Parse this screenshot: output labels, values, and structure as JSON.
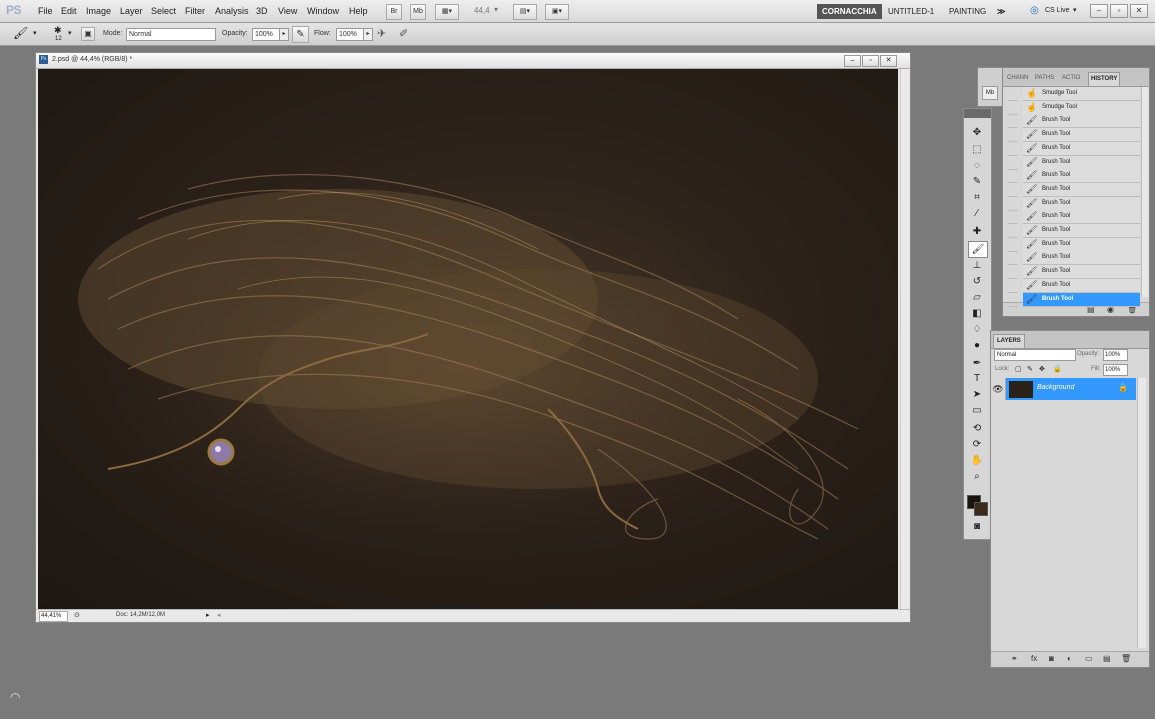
{
  "menubar": {
    "logo": "PS",
    "items": [
      "File",
      "Edit",
      "Image",
      "Layer",
      "Select",
      "Filter",
      "Analysis",
      "3D",
      "View",
      "Window",
      "Help"
    ],
    "zoom": "44,4",
    "workspaces": [
      "CORNACCHIA",
      "UNTITLED-1",
      "PAINTING"
    ],
    "more": "≫",
    "cslive": "CS Live"
  },
  "options": {
    "brush_size": "12",
    "mode_label": "Mode:",
    "mode_value": "Normal",
    "opacity_label": "Opacity:",
    "opacity_value": "100%",
    "flow_label": "Flow:",
    "flow_value": "100%"
  },
  "document": {
    "title": "2.psd @ 44,4% (RGB/8) *",
    "zoom": "44,41%",
    "doc_info": "Doc: 14,2M/12,0M"
  },
  "history": {
    "tabs": [
      "CHANN",
      "PATHS",
      "ACTIO",
      "HISTORY"
    ],
    "items": [
      "Smudge Tool",
      "Smudge Tool",
      "Brush Tool",
      "Brush Tool",
      "Brush Tool",
      "Brush Tool",
      "Brush Tool",
      "Brush Tool",
      "Brush Tool",
      "Brush Tool",
      "Brush Tool",
      "Brush Tool",
      "Brush Tool",
      "Brush Tool",
      "Brush Tool",
      "Brush Tool"
    ],
    "selected": "Brush Tool"
  },
  "layers": {
    "tab": "LAYERS",
    "blend_mode": "Normal",
    "opacity_label": "Opacity:",
    "opacity_value": "100%",
    "lock_label": "Lock:",
    "fill_label": "Fill:",
    "fill_value": "100%",
    "layer_name": "Background"
  },
  "colors": {
    "menubar": "#e4e4e4",
    "canvas_bg": "#2b2119",
    "selection": "#3399ff",
    "active_workspace": "#555555",
    "hair": "#9a7a52"
  },
  "icons": {
    "tools": [
      "move-icon",
      "marquee-icon",
      "lasso-icon",
      "quick-select-icon",
      "crop-icon",
      "eyedropper-icon",
      "spot-heal-icon",
      "brush-icon",
      "clone-stamp-icon",
      "history-brush-icon",
      "eraser-icon",
      "gradient-icon",
      "blur-icon",
      "dodge-icon",
      "pen-icon",
      "type-icon",
      "path-select-icon",
      "shape-icon",
      "3d-rotate-icon",
      "3d-orbit-icon",
      "hand-icon",
      "zoom-icon"
    ]
  }
}
